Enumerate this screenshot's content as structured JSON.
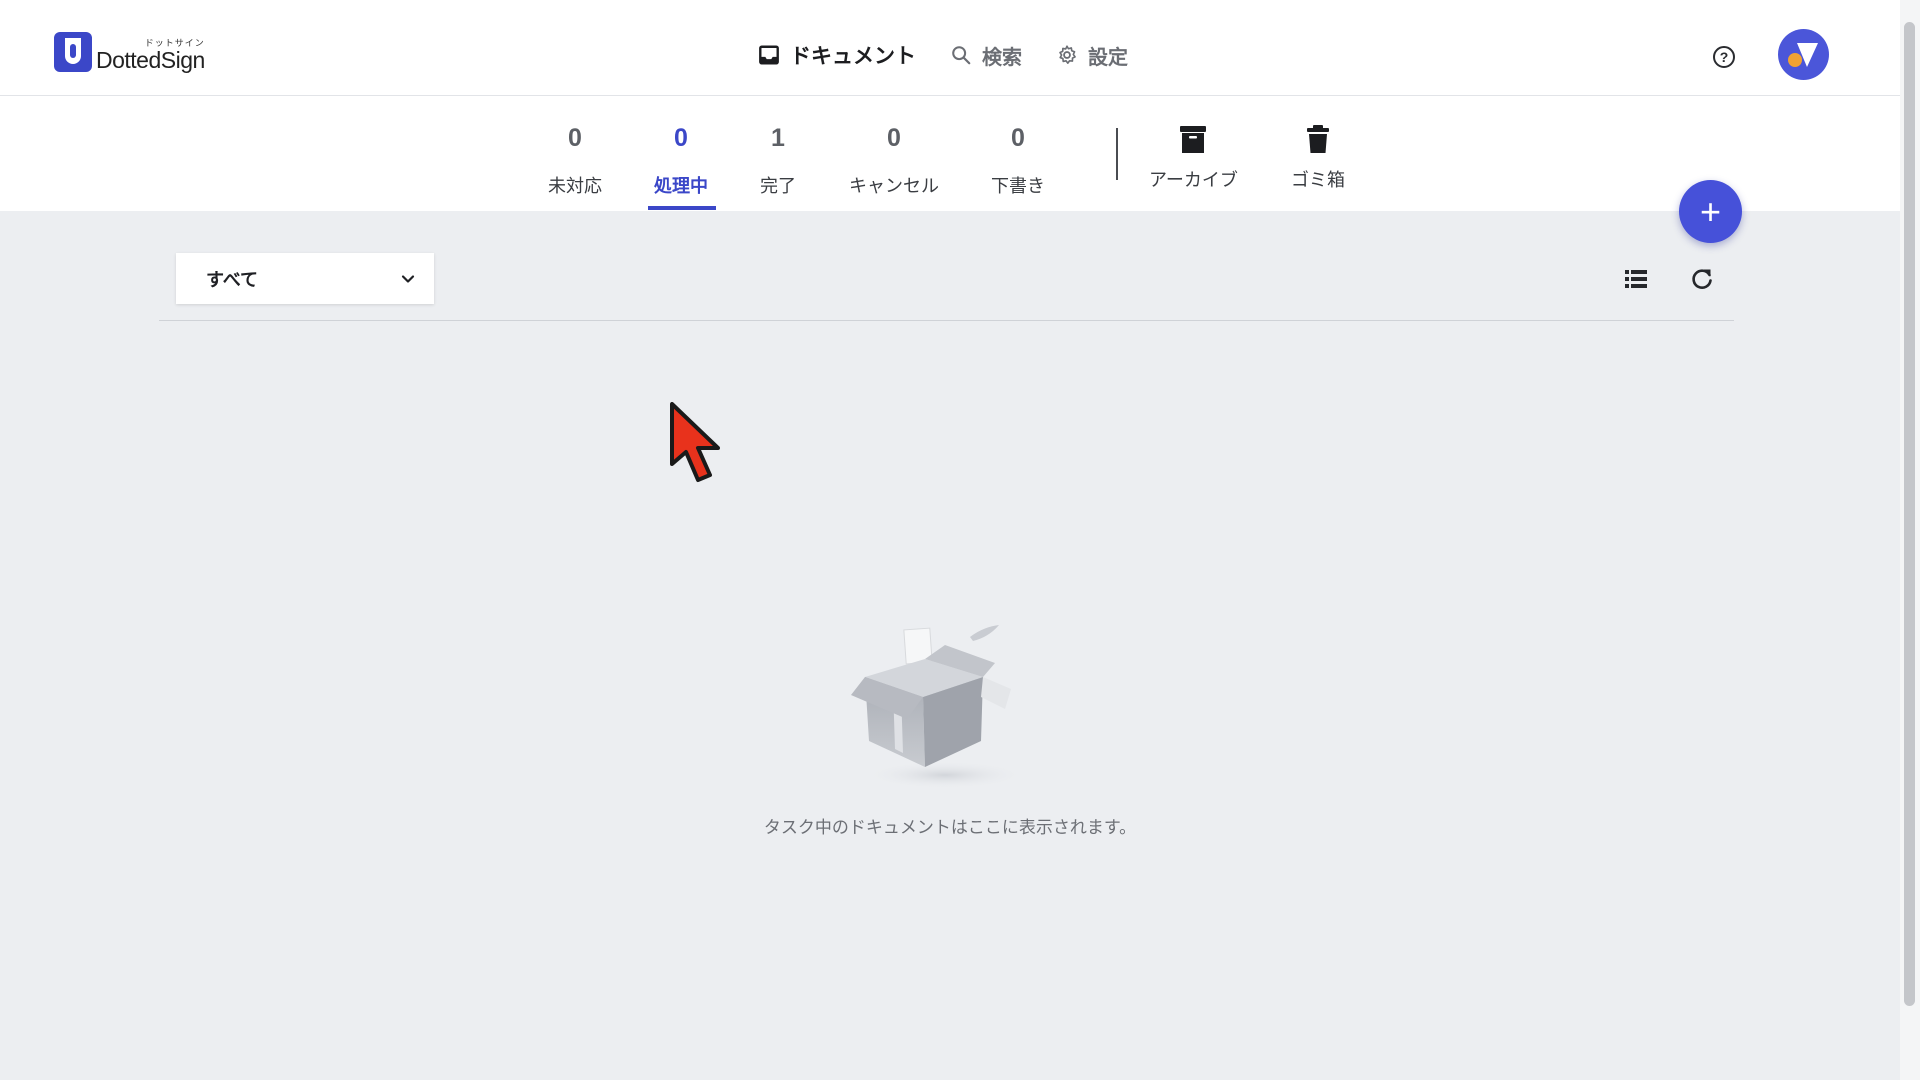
{
  "app": {
    "logo_name": "DottedSign",
    "logo_kana": "ドットサイン"
  },
  "nav": {
    "items": [
      {
        "label": "ドキュメント",
        "icon": "inbox-icon",
        "active": true
      },
      {
        "label": "検索",
        "icon": "search-icon",
        "active": false
      },
      {
        "label": "設定",
        "icon": "gear-icon",
        "active": false
      }
    ],
    "help_icon": "help-circle-icon",
    "help_glyph": "?"
  },
  "tabs": [
    {
      "count": "0",
      "label": "未対応",
      "active": false
    },
    {
      "count": "0",
      "label": "処理中",
      "active": true
    },
    {
      "count": "1",
      "label": "完了",
      "active": false
    },
    {
      "count": "0",
      "label": "キャンセル",
      "active": false
    },
    {
      "count": "0",
      "label": "下書き",
      "active": false
    }
  ],
  "folders": [
    {
      "label": "アーカイブ",
      "icon": "archive-icon"
    },
    {
      "label": "ゴミ箱",
      "icon": "trash-icon"
    }
  ],
  "fab": {
    "glyph": "+"
  },
  "filter": {
    "selected": "すべて"
  },
  "empty_state": {
    "message": "タスク中のドキュメントはここに表示されます。"
  },
  "colors": {
    "accent": "#3b47c8",
    "fab": "#4651d9",
    "background": "#eceef1"
  }
}
